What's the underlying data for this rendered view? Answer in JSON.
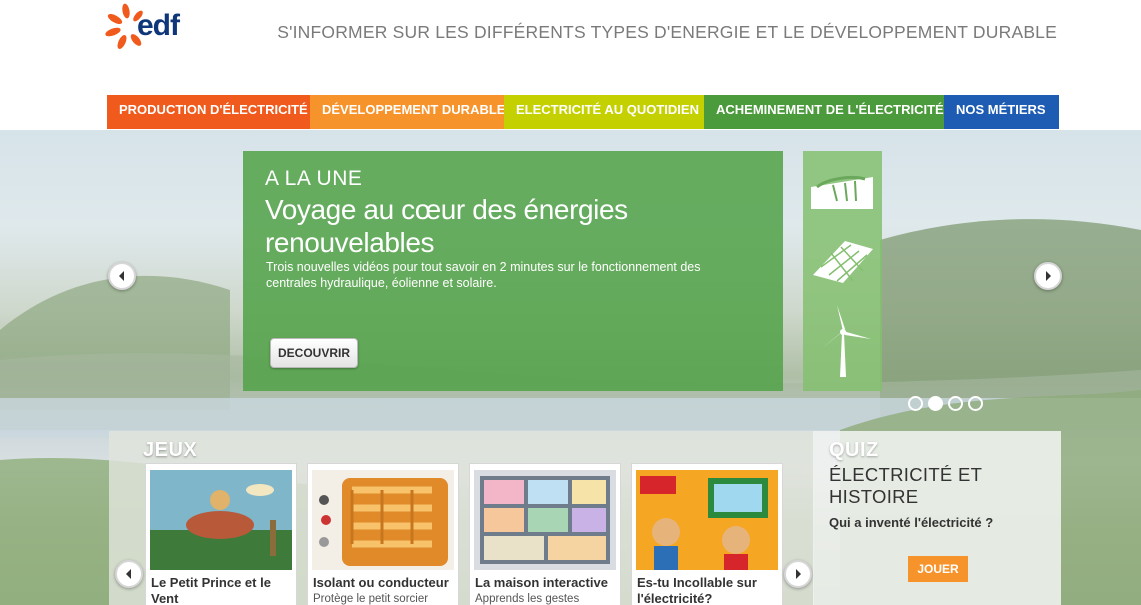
{
  "brand": {
    "logo_text": "edf",
    "colors": {
      "orange": "#f05a1c",
      "blue": "#10367a",
      "green": "#52a248"
    }
  },
  "header": {
    "tagline": "S'INFORMER SUR LES DIFFÉRENTS TYPES D'ENERGIE ET LE DÉVELOPPEMENT DURABLE"
  },
  "nav": {
    "items": [
      {
        "label": "PRODUCTION D'ÉLECTRICITÉ",
        "color": "#f05a1c"
      },
      {
        "label": "DÉVELOPPEMENT DURABLE",
        "color": "#f7932b"
      },
      {
        "label": "ELECTRICITÉ AU QUOTIDIEN",
        "color": "#c4d000"
      },
      {
        "label": "ACHEMINEMENT DE L'ÉLECTRICITÉ",
        "color": "#4b9a3c"
      },
      {
        "label": "NOS MÉTIERS",
        "color": "#1e5cb4"
      }
    ]
  },
  "carousel": {
    "kicker": "A LA UNE",
    "title": "Voyage au cœur des énergies renouvelables",
    "description": "Trois nouvelles vidéos pour tout savoir en 2 minutes sur le fonctionnement des centrales hydraulique, éolienne et solaire.",
    "button_label": "DECOUVRIR",
    "thumbnails": [
      "dam-icon",
      "solar-panel-icon",
      "wind-turbine-icon"
    ],
    "active_slide": 2,
    "slide_count": 4
  },
  "games": {
    "title": "JEUX",
    "items": [
      {
        "title": "Le Petit Prince et le Vent",
        "subtitle": ""
      },
      {
        "title": "Isolant ou conducteur",
        "subtitle": "Protège le petit sorcier"
      },
      {
        "title": "La maison interactive",
        "subtitle": "Apprends les gestes"
      },
      {
        "title": "Es-tu Incollable sur l'électricité?",
        "subtitle": ""
      }
    ]
  },
  "quiz": {
    "title": "QUIZ",
    "subject": "ÉLECTRICITÉ ET HISTOIRE",
    "question": "Qui a inventé l'électricité ?",
    "button_label": "JOUER"
  }
}
